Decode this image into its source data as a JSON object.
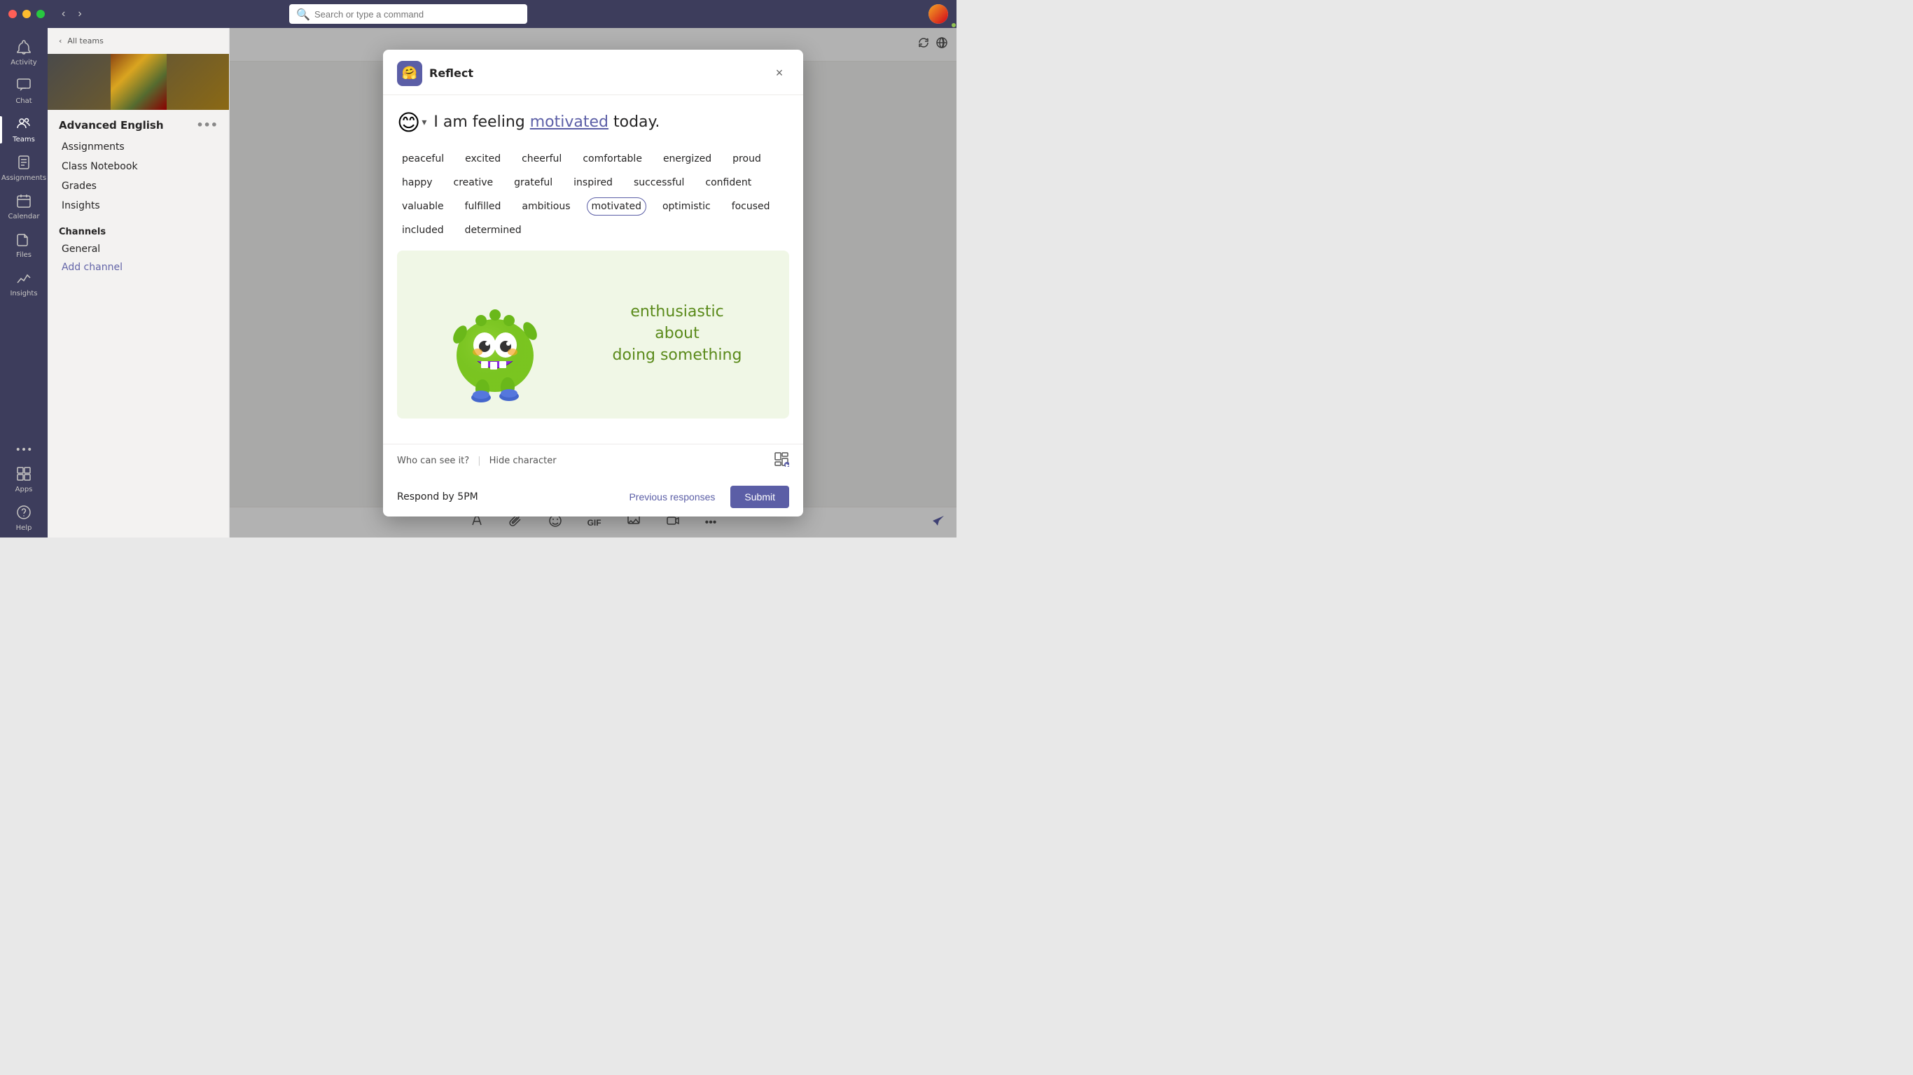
{
  "titlebar": {
    "search_placeholder": "Search or type a command",
    "traffic_lights": [
      "close",
      "minimize",
      "maximize"
    ]
  },
  "sidebar": {
    "back_label": "All teams",
    "team_name": "Advanced English",
    "nav_items": [
      {
        "label": "Assignments"
      },
      {
        "label": "Class Notebook"
      },
      {
        "label": "Grades"
      },
      {
        "label": "Insights"
      }
    ],
    "channels_header": "Channels",
    "channel_items": [
      "General"
    ],
    "add_channel_label": "Add channel"
  },
  "left_rail": {
    "items": [
      {
        "label": "Activity",
        "icon": "🔔"
      },
      {
        "label": "Chat",
        "icon": "💬"
      },
      {
        "label": "Teams",
        "icon": "👥"
      },
      {
        "label": "Assignments",
        "icon": "📋"
      },
      {
        "label": "Calendar",
        "icon": "📅"
      },
      {
        "label": "Files",
        "icon": "📁"
      },
      {
        "label": "Insights",
        "icon": "📊"
      }
    ],
    "bottom_items": [
      {
        "label": "Apps",
        "icon": "⊞"
      },
      {
        "label": "Help",
        "icon": "❓"
      }
    ],
    "more_icon": "···"
  },
  "modal": {
    "title": "Reflect",
    "icon_emoji": "🤗",
    "close_label": "×",
    "feeling_prefix": "I am feeling ",
    "feeling_word": "motivated",
    "feeling_suffix": " today.",
    "emotions": [
      {
        "label": "peaceful",
        "selected": false
      },
      {
        "label": "excited",
        "selected": false
      },
      {
        "label": "cheerful",
        "selected": false
      },
      {
        "label": "comfortable",
        "selected": false
      },
      {
        "label": "energized",
        "selected": false
      },
      {
        "label": "proud",
        "selected": false
      },
      {
        "label": "happy",
        "selected": false
      },
      {
        "label": "creative",
        "selected": false
      },
      {
        "label": "grateful",
        "selected": false
      },
      {
        "label": "inspired",
        "selected": false
      },
      {
        "label": "successful",
        "selected": false
      },
      {
        "label": "confident",
        "selected": false
      },
      {
        "label": "valuable",
        "selected": false
      },
      {
        "label": "fulfilled",
        "selected": false
      },
      {
        "label": "ambitious",
        "selected": false
      },
      {
        "label": "motivated",
        "selected": true
      },
      {
        "label": "optimistic",
        "selected": false
      },
      {
        "label": "focused",
        "selected": false
      },
      {
        "label": "included",
        "selected": false
      },
      {
        "label": "determined",
        "selected": false
      }
    ],
    "character_description_line1": "enthusiastic about",
    "character_description_line2": "doing something",
    "who_can_see": "Who can see it?",
    "hide_character": "Hide character",
    "respond_by": "Respond by 5PM",
    "previous_responses_label": "Previous responses",
    "submit_label": "Submit"
  },
  "bottom_toolbar": {
    "tools": [
      {
        "name": "format",
        "icon": "✏️"
      },
      {
        "name": "attach",
        "icon": "📎"
      },
      {
        "name": "emoji",
        "icon": "😊"
      },
      {
        "name": "gif",
        "icon": "GIF"
      },
      {
        "name": "sticker",
        "icon": "🗒️"
      },
      {
        "name": "video",
        "icon": "🎥"
      },
      {
        "name": "more",
        "icon": "···"
      }
    ],
    "send_icon": "➤"
  }
}
